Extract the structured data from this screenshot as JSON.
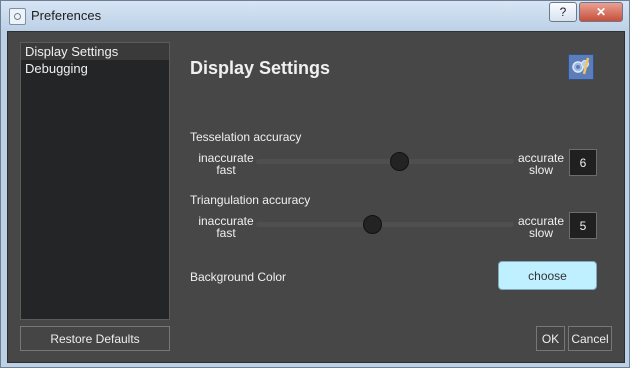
{
  "window": {
    "title": "Preferences",
    "help_label": "?",
    "close_label": "✕"
  },
  "sidebar": {
    "items": [
      {
        "label": "Display Settings",
        "selected": true
      },
      {
        "label": "Debugging",
        "selected": false
      }
    ],
    "restore_defaults_label": "Restore Defaults"
  },
  "page": {
    "title": "Display Settings",
    "icon": "settings-gears-icon"
  },
  "tesselation": {
    "label": "Tesselation accuracy",
    "left_line1": "inaccurate",
    "left_line2": "fast",
    "right_line1": "accurate",
    "right_line2": "slow",
    "value": "6",
    "min": 1,
    "max": 10
  },
  "triangulation": {
    "label": "Triangulation accuracy",
    "left_line1": "inaccurate",
    "left_line2": "fast",
    "right_line1": "accurate",
    "right_line2": "slow",
    "value": "5",
    "min": 1,
    "max": 10
  },
  "background_color": {
    "label": "Background Color",
    "button_label": "choose",
    "swatch_color": "#bff0ff"
  },
  "footer": {
    "ok_label": "OK",
    "cancel_label": "Cancel"
  }
}
